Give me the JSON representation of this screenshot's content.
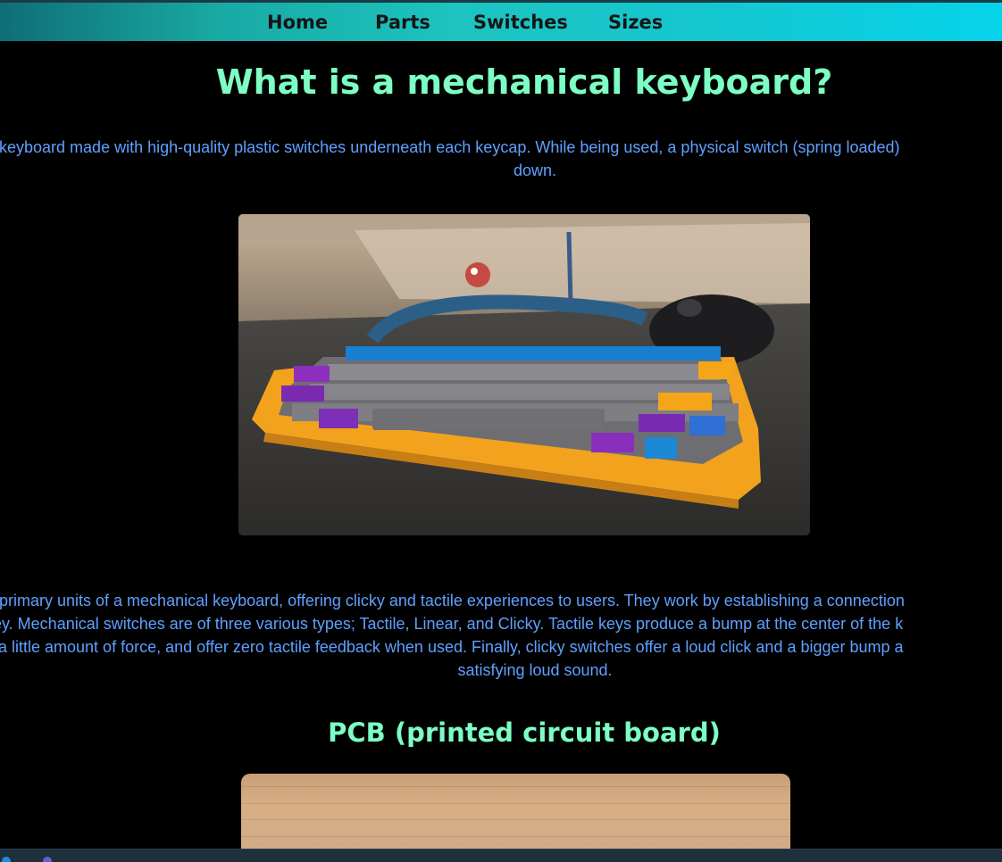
{
  "nav": {
    "items": [
      {
        "label": "Home"
      },
      {
        "label": "Parts"
      },
      {
        "label": "Switches"
      },
      {
        "label": "Sizes"
      }
    ]
  },
  "main": {
    "title": "What is a mechanical keyboard?",
    "intro_lines": [
      "keyboard made with high-quality plastic switches underneath each keycap. While being used, a physical switch (spring loaded)",
      "down."
    ],
    "switches_lines": [
      "primary units of a mechanical keyboard, offering clicky and tactile experiences to users. They work by establishing a connection",
      "ey. Mechanical switches are of three various types; Tactile, Linear, and Clicky. Tactile keys produce a bump at the center of the k",
      "a little amount of force, and offer zero tactile feedback when used. Finally, clicky switches offer a loud click and a bigger bump a",
      "satisfying loud sound."
    ],
    "pcb_title": "PCB (printed circuit board)",
    "keyboard_image": {
      "description_icon": "keyboard-photo"
    },
    "pcb_image": {
      "description_icon": "wood-photo"
    }
  },
  "colors": {
    "heading": "#7dffc3",
    "text": "#5fa0ff",
    "nav_text": "#151515",
    "background": "#000000"
  }
}
